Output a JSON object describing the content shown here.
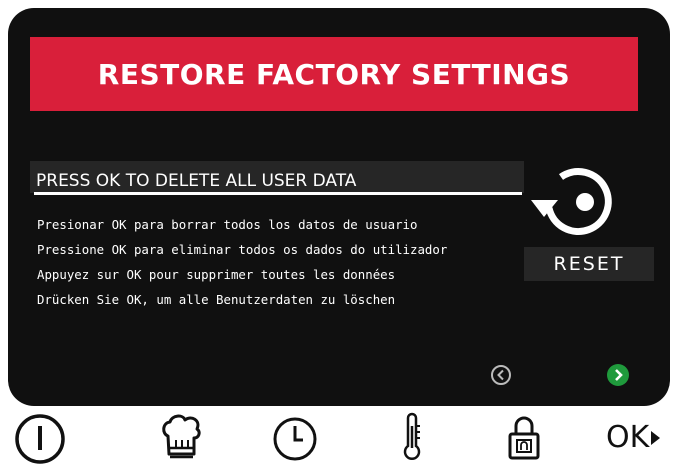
{
  "screen": {
    "title": "RESTORE FACTORY SETTINGS",
    "headline": "PRESS OK TO DELETE ALL USER DATA",
    "translations": [
      "Presionar OK para borrar todos los datos de usuario",
      "Pressione OK para eliminar todos os dados do utilizador",
      "Appuyez sur OK pour supprimer toutes les données",
      "Drücken Sie OK, um alle Benutzerdaten zu löschen"
    ],
    "reset_label": "RESET",
    "nav": {
      "prev_icon": "chevron-left-circle-icon",
      "next_icon": "chevron-right-circle-icon"
    }
  },
  "bottom_bar": {
    "buttons": [
      {
        "icon": "power-icon"
      },
      {
        "icon": "chef-hat-icon"
      },
      {
        "icon": "clock-icon"
      },
      {
        "icon": "thermometer-icon"
      },
      {
        "icon": "lock-icon"
      }
    ],
    "ok_label": "OK"
  },
  "colors": {
    "banner_red": "#d91f3a",
    "screen_bg": "#101010",
    "next_green": "#1f9a3c"
  }
}
